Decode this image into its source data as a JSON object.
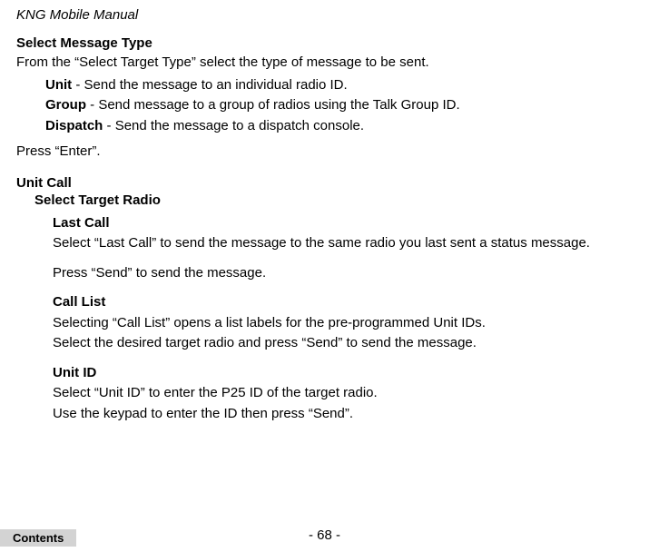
{
  "header": {
    "title": "KNG Mobile Manual"
  },
  "selectMessageType": {
    "heading": "Select Message Type",
    "intro": "From the “Select Target Type” select the type of message to be sent.",
    "items": [
      {
        "term": "Unit",
        "desc": " - Send the message to an individual radio ID."
      },
      {
        "term": "Group",
        "desc": " - Send message to a group of radios using the Talk Group ID."
      },
      {
        "term": "Dispatch",
        "desc": " - Send the message to a dispatch console."
      }
    ],
    "pressEnter": "Press “Enter”."
  },
  "unitCall": {
    "heading": "Unit Call",
    "subHeading": "Select Target Radio",
    "lastCall": {
      "title": "Last Call",
      "line1": "Select “Last Call” to send the message to the same radio you last sent a status message.",
      "line2": "Press “Send” to send the message."
    },
    "callList": {
      "title": "Call List",
      "line1": "Selecting “Call List” opens a list labels for the pre-programmed Unit IDs.",
      "line2": "Select the desired target radio and press “Send” to send the message."
    },
    "unitId": {
      "title": "Unit ID",
      "line1": "Select “Unit ID” to enter the P25 ID of the target radio.",
      "line2": "Use the keypad to enter the ID then press “Send”."
    }
  },
  "footer": {
    "pageNumber": "- 68 -",
    "contentsLabel": "Contents"
  }
}
